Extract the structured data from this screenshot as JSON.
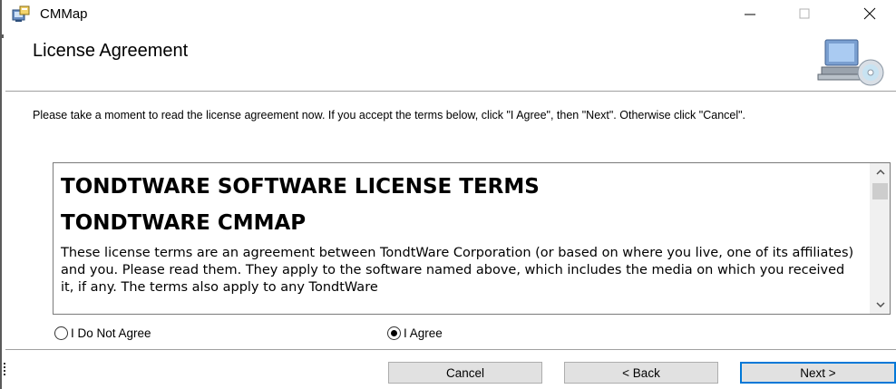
{
  "window": {
    "title": "CMMap",
    "minimize_glyph": "—",
    "maximize_glyph": "☐",
    "close_glyph": "✕",
    "app_icon": "installer-icon"
  },
  "header": {
    "title": "License Agreement",
    "art_icon": "computer-cd-icon"
  },
  "instructions": "Please take a moment to read the license agreement now. If you accept the terms below, click \"I Agree\", then \"Next\". Otherwise click \"Cancel\".",
  "license": {
    "heading1": "TONDTWARE SOFTWARE LICENSE TERMS",
    "heading2": "TONDTWARE CMMAP",
    "body": "These license terms are an agreement between TondtWare Corporation (or based on where you live, one of its affiliates) and you.  Please read them. They apply to the software named above, which includes the media on which you received it, if any.  The terms also apply to any TondtWare"
  },
  "options": {
    "disagree_label": "I Do Not Agree",
    "agree_label": "I Agree",
    "selected": "agree"
  },
  "buttons": {
    "cancel_label": "Cancel",
    "back_label": "< Back",
    "next_label": "Next >"
  },
  "colors": {
    "focus_border": "#0078d7",
    "button_face": "#e1e1e1"
  }
}
